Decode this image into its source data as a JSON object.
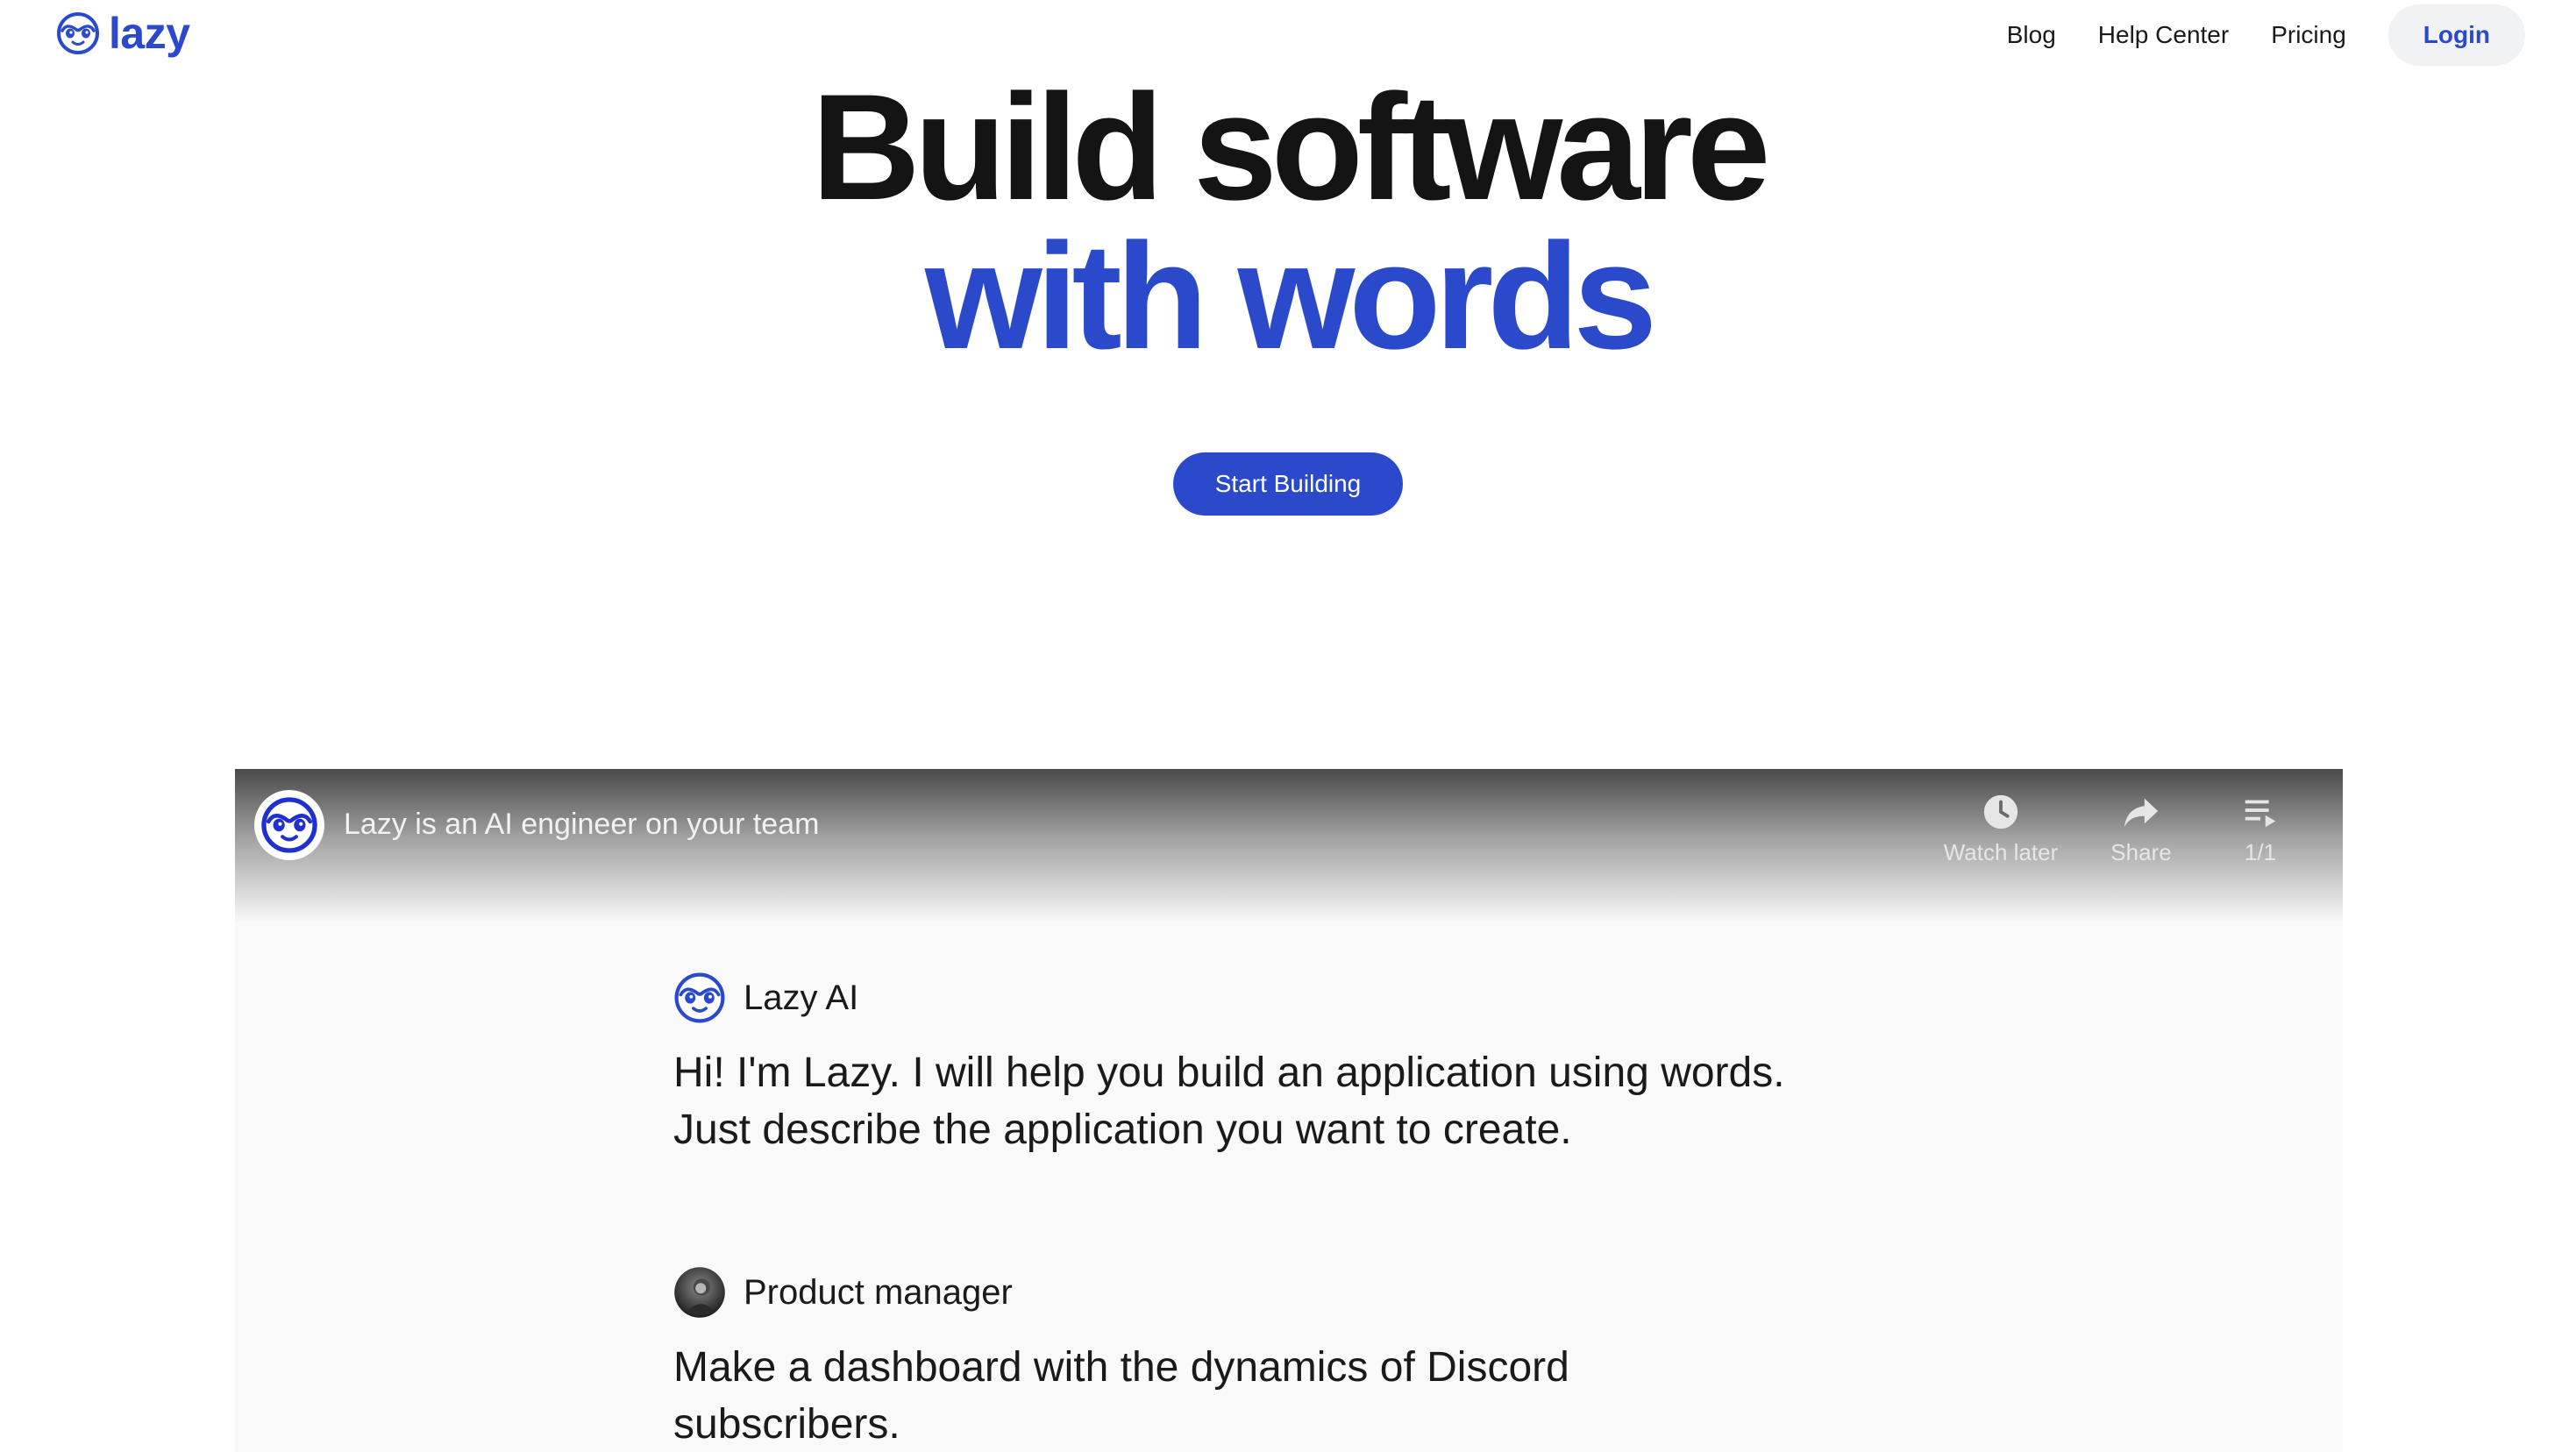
{
  "brand": {
    "name": "lazy",
    "icon": "sloth-face-icon",
    "color": "#2b4acb"
  },
  "nav": {
    "blog": "Blog",
    "help_center": "Help Center",
    "pricing": "Pricing",
    "login": "Login"
  },
  "hero": {
    "line1": "Build software",
    "line2": "with words",
    "cta": "Start Building",
    "accent_color": "#2b4acb"
  },
  "video": {
    "title": "Lazy is an AI engineer on your team",
    "channel_icon": "sloth-face-icon",
    "actions": {
      "watch_later": "Watch later",
      "share": "Share",
      "playlist": "1/1"
    },
    "messages": [
      {
        "author": "Lazy AI",
        "avatar": "sloth-face-icon",
        "lines": [
          "Hi! I'm Lazy. I will help you build an application using words.",
          "Just describe the application you want to create."
        ]
      },
      {
        "author": "Product manager",
        "avatar": "user-photo-avatar",
        "lines": [
          "Make a dashboard with the dynamics of Discord",
          "subscribers."
        ]
      }
    ]
  }
}
